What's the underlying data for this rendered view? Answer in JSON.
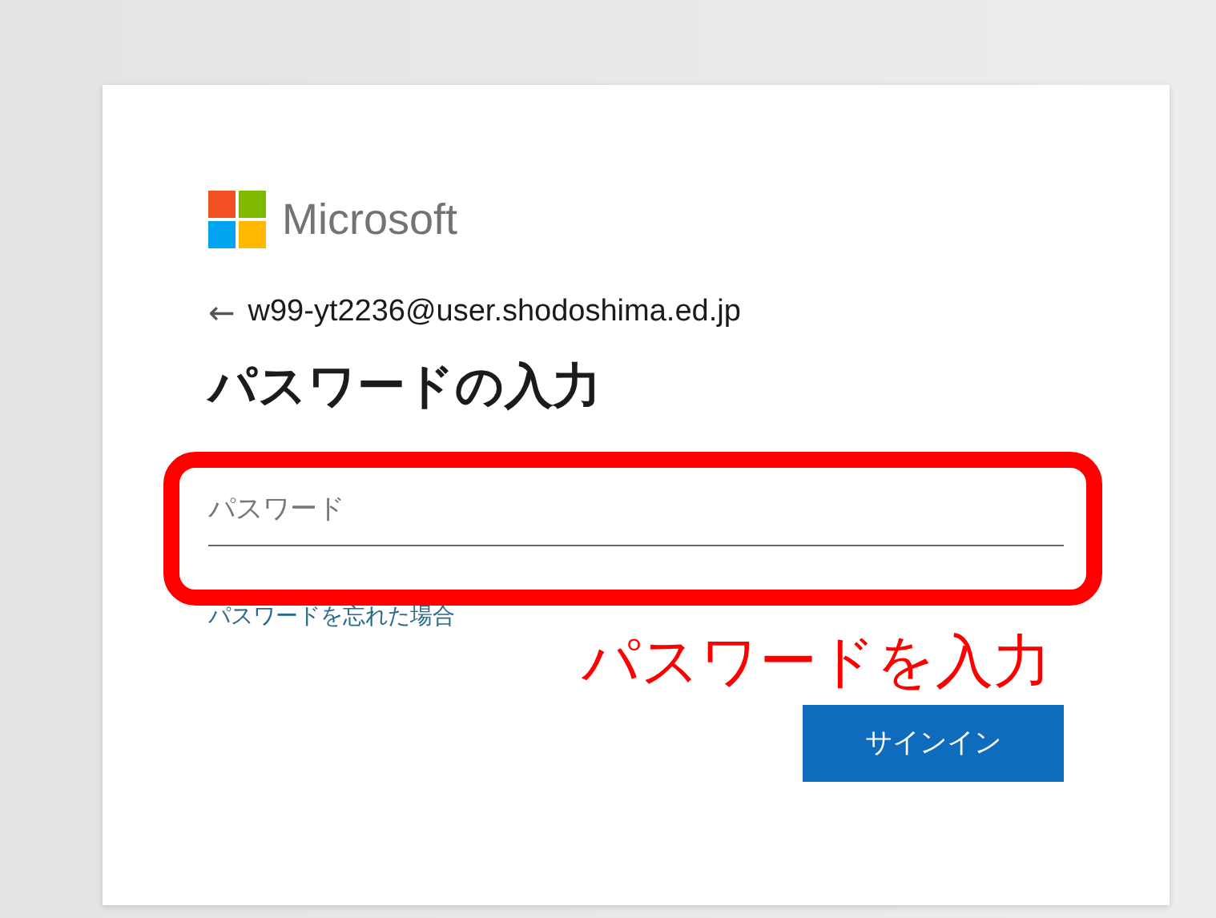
{
  "logo": {
    "text": "Microsoft"
  },
  "identity": {
    "back": "←",
    "email": "w99-yt2236@user.shodoshima.ed.jp"
  },
  "heading": "パスワードの入力",
  "password": {
    "placeholder": "パスワード"
  },
  "forgot_link": "パスワードを忘れた場合",
  "annotation": "パスワードを入力",
  "sign_in_button": "サインイン"
}
